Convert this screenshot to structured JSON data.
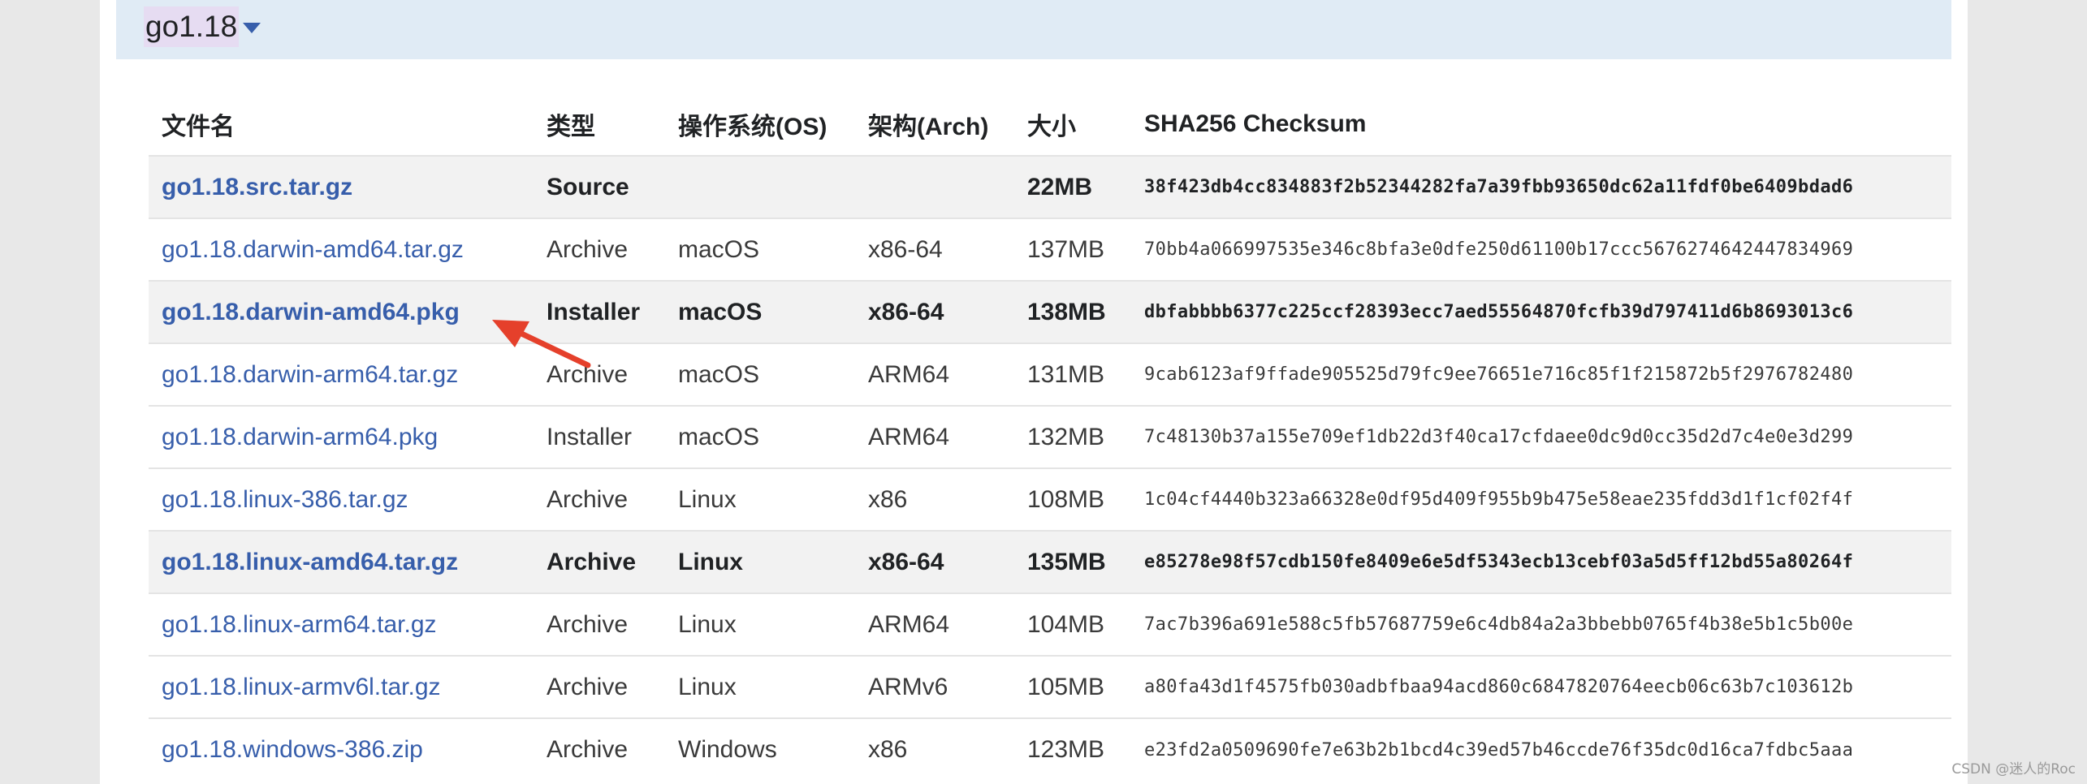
{
  "version": {
    "title": "go1.18"
  },
  "table": {
    "headers": {
      "filename": "文件名",
      "kind": "类型",
      "os": "操作系统(OS)",
      "arch": "架构(Arch)",
      "size": "大小",
      "checksum": "SHA256 Checksum"
    },
    "rows": [
      {
        "filename": "go1.18.src.tar.gz",
        "kind": "Source",
        "os": "",
        "arch": "",
        "size": "22MB",
        "checksum": "38f423db4cc834883f2b52344282fa7a39fbb93650dc62a11fdf0be6409bdad6",
        "featured": true
      },
      {
        "filename": "go1.18.darwin-amd64.tar.gz",
        "kind": "Archive",
        "os": "macOS",
        "arch": "x86-64",
        "size": "137MB",
        "checksum": "70bb4a066997535e346c8bfa3e0dfe250d61100b17ccc5676274642447834969",
        "featured": false
      },
      {
        "filename": "go1.18.darwin-amd64.pkg",
        "kind": "Installer",
        "os": "macOS",
        "arch": "x86-64",
        "size": "138MB",
        "checksum": "dbfabbbb6377c225ccf28393ecc7aed55564870fcfb39d797411d6b8693013c6",
        "featured": true
      },
      {
        "filename": "go1.18.darwin-arm64.tar.gz",
        "kind": "Archive",
        "os": "macOS",
        "arch": "ARM64",
        "size": "131MB",
        "checksum": "9cab6123af9ffade905525d79fc9ee76651e716c85f1f215872b5f2976782480",
        "featured": false
      },
      {
        "filename": "go1.18.darwin-arm64.pkg",
        "kind": "Installer",
        "os": "macOS",
        "arch": "ARM64",
        "size": "132MB",
        "checksum": "7c48130b37a155e709ef1db22d3f40ca17cfdaee0dc9d0cc35d2d7c4e0e3d299",
        "featured": false
      },
      {
        "filename": "go1.18.linux-386.tar.gz",
        "kind": "Archive",
        "os": "Linux",
        "arch": "x86",
        "size": "108MB",
        "checksum": "1c04cf4440b323a66328e0df95d409f955b9b475e58eae235fdd3d1f1cf02f4f",
        "featured": false
      },
      {
        "filename": "go1.18.linux-amd64.tar.gz",
        "kind": "Archive",
        "os": "Linux",
        "arch": "x86-64",
        "size": "135MB",
        "checksum": "e85278e98f57cdb150fe8409e6e5df5343ecb13cebf03a5d5ff12bd55a80264f",
        "featured": true
      },
      {
        "filename": "go1.18.linux-arm64.tar.gz",
        "kind": "Archive",
        "os": "Linux",
        "arch": "ARM64",
        "size": "104MB",
        "checksum": "7ac7b396a691e588c5fb57687759e6c4db84a2a3bbebb0765f4b38e5b1c5b00e",
        "featured": false
      },
      {
        "filename": "go1.18.linux-armv6l.tar.gz",
        "kind": "Archive",
        "os": "Linux",
        "arch": "ARMv6",
        "size": "105MB",
        "checksum": "a80fa43d1f4575fb030adbfbaa94acd860c6847820764eecb06c63b7c103612b",
        "featured": false
      },
      {
        "filename": "go1.18.windows-386.zip",
        "kind": "Archive",
        "os": "Windows",
        "arch": "x86",
        "size": "123MB",
        "checksum": "e23fd2a0509690fe7e63b2b1bcd4c39ed57b46ccde76f35dc0d16ca7fdbc5aaa",
        "featured": false
      }
    ]
  },
  "watermark": "CSDN @迷人的Roc",
  "colors": {
    "link": "#375eab",
    "header_bg": "#e0ebf5",
    "arrow": "#e5402b"
  },
  "icons": {
    "toggle": "chevron-down-icon",
    "annotation": "red-arrow-icon"
  }
}
